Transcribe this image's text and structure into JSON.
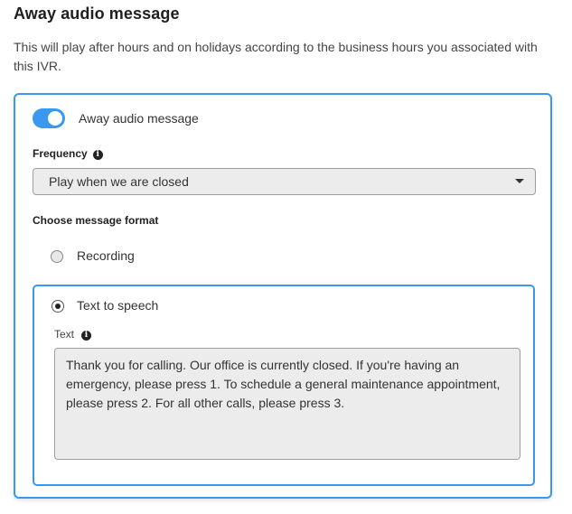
{
  "header": {
    "title": "Away audio message",
    "description": "This will play after hours and on holidays according to the business hours you associated with this IVR."
  },
  "card": {
    "toggle": {
      "label": "Away audio message",
      "enabled": true
    },
    "frequency": {
      "label": "Frequency",
      "info_icon": "info-icon",
      "selected": "Play when we are closed"
    },
    "format": {
      "label": "Choose message format",
      "options": [
        {
          "label": "Recording",
          "selected": false
        },
        {
          "label": "Text to speech",
          "selected": true
        }
      ]
    },
    "tts": {
      "text_label": "Text",
      "info_icon": "info-icon",
      "text_value": "Thank you for calling. Our office is currently closed. If you're having an emergency, please press 1. To schedule a general maintenance appointment, please press 2. For all other calls, please press 3."
    }
  },
  "colors": {
    "accent": "#3b98f0",
    "field_background": "#ececec"
  }
}
